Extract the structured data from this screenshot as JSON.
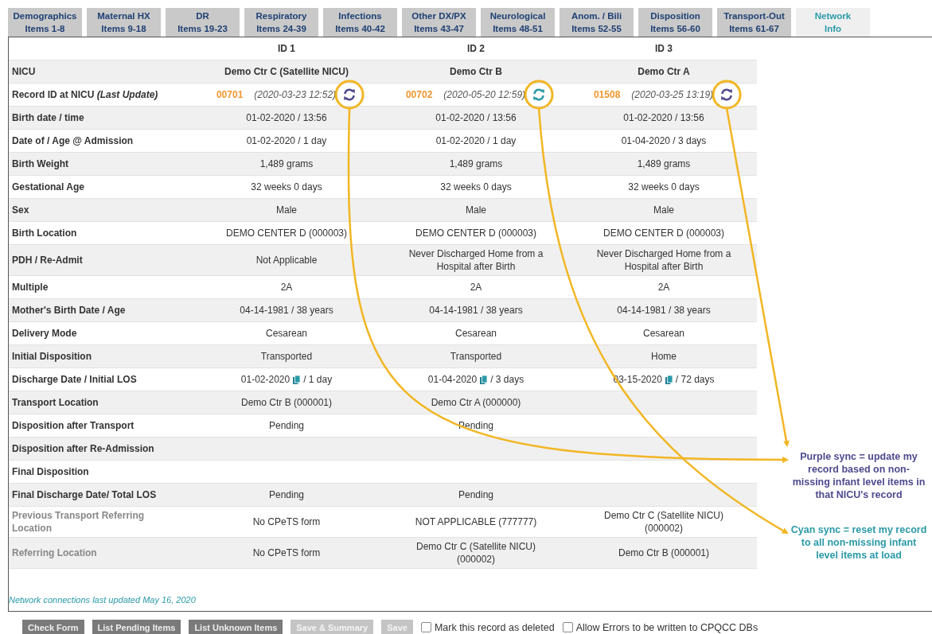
{
  "tabs": [
    {
      "title": "Demographics",
      "items": "Items 1-8",
      "selected": false
    },
    {
      "title": "Maternal HX",
      "items": "Items 9-18",
      "selected": false
    },
    {
      "title": "DR",
      "items": "Items 19-23",
      "selected": false
    },
    {
      "title": "Respiratory",
      "items": "Items 24-39",
      "selected": false
    },
    {
      "title": "Infections",
      "items": "Items 40-42",
      "selected": false
    },
    {
      "title": "Other DX/PX",
      "items": "Items 43-47",
      "selected": false
    },
    {
      "title": "Neurological",
      "items": "Items 48-51",
      "selected": false
    },
    {
      "title": "Anom. / Bili",
      "items": "Items 52-55",
      "selected": false
    },
    {
      "title": "Disposition",
      "items": "Items 56-60",
      "selected": false
    },
    {
      "title": "Transport-Out",
      "items": "Items 61-67",
      "selected": false
    },
    {
      "title": "Network",
      "items": "Info",
      "selected": true
    }
  ],
  "table": {
    "columns": [
      "ID 1",
      "ID 2",
      "ID 3"
    ],
    "rows": [
      {
        "kind": "heading",
        "label": "NICU",
        "cells": [
          "Demo Ctr C (Satellite NICU)",
          "Demo Ctr B",
          "Demo Ctr A"
        ]
      },
      {
        "kind": "record",
        "label": "Record ID at NICU *(Last Update)*",
        "cells": [
          {
            "id": "00701",
            "updated": "(2020-03-23 12:52)",
            "color": "#4f4a8f"
          },
          {
            "id": "00702",
            "updated": "(2020-05-20 12:59)",
            "color": "#2a9aa8"
          },
          {
            "id": "01508",
            "updated": "(2020-03-25 13:19)",
            "color": "#4f4a8f"
          }
        ]
      },
      {
        "kind": "plain",
        "label": "Birth date / time",
        "cells": [
          "01-02-2020 / 13:56",
          "01-02-2020 / 13:56",
          "01-02-2020 / 13:56"
        ]
      },
      {
        "kind": "plain",
        "label": "Date of / Age @ Admission",
        "cells": [
          "01-02-2020 / 1 day",
          "01-02-2020 / 1 day",
          "01-04-2020 / 3 days"
        ]
      },
      {
        "kind": "plain",
        "label": "Birth Weight",
        "cells": [
          "1,489 grams",
          "1,489 grams",
          "1,489 grams"
        ]
      },
      {
        "kind": "plain",
        "label": "Gestational Age",
        "cells": [
          "32 weeks 0 days",
          "32 weeks 0 days",
          "32 weeks 0 days"
        ]
      },
      {
        "kind": "plain",
        "label": "Sex",
        "cells": [
          "Male",
          "Male",
          "Male"
        ]
      },
      {
        "kind": "plain",
        "label": "Birth Location",
        "cells": [
          "DEMO CENTER D (000003)",
          "DEMO CENTER D (000003)",
          "DEMO CENTER D (000003)"
        ]
      },
      {
        "kind": "plain",
        "label": "PDH / Re-Admit",
        "cells": [
          "Not Applicable",
          "Never Discharged Home from a Hospital after Birth",
          "Never Discharged Home from a Hospital after Birth"
        ]
      },
      {
        "kind": "plain",
        "label": "Multiple",
        "cells": [
          "2A",
          "2A",
          "2A"
        ]
      },
      {
        "kind": "plain",
        "label": "Mother's Birth Date / Age",
        "cells": [
          "04-14-1981 / 38 years",
          "04-14-1981 / 38 years",
          "04-14-1981 / 38 years"
        ]
      },
      {
        "kind": "plain",
        "label": "Delivery Mode",
        "cells": [
          "Cesarean",
          "Cesarean",
          "Cesarean"
        ]
      },
      {
        "kind": "plain",
        "label": "Initial Disposition",
        "cells": [
          "Transported",
          "Transported",
          "Home"
        ]
      },
      {
        "kind": "discharge",
        "label": "Discharge Date / Initial LOS",
        "cells": [
          {
            "date": "01-02-2020",
            "rest": "/ 1 day"
          },
          {
            "date": "01-04-2020",
            "rest": "/ 3 days"
          },
          {
            "date": "03-15-2020",
            "rest": "/ 72 days"
          }
        ]
      },
      {
        "kind": "plain",
        "label": "Transport Location",
        "cells": [
          "Demo Ctr B (000001)",
          "Demo Ctr A (000000)",
          null
        ]
      },
      {
        "kind": "plain",
        "label": "Disposition after Transport",
        "cells": [
          "Pending",
          "Pending",
          null
        ]
      },
      {
        "kind": "plain",
        "label": "Disposition after Re-Admission",
        "cells": [
          null,
          null,
          null
        ]
      },
      {
        "kind": "plain",
        "label": "Final Disposition",
        "cells": [
          null,
          null,
          null
        ]
      },
      {
        "kind": "plain",
        "label": "Final Discharge Date/ Total LOS",
        "cells": [
          "Pending",
          "Pending",
          null
        ]
      },
      {
        "kind": "muted",
        "label": "Previous Transport Referring Location",
        "cells": [
          "No CPeTS form",
          "NOT APPLICABLE (777777)",
          "Demo Ctr C (Satellite NICU) (000002)"
        ]
      },
      {
        "kind": "muted",
        "label": "Referring Location",
        "cells": [
          "No CPeTS form",
          "Demo Ctr C (Satellite NICU) (000002)",
          "Demo Ctr B (000001)"
        ]
      }
    ]
  },
  "notes": [
    {
      "text": "Purple sync = update my record based on non-missing infant level items in that NICU's record",
      "color": "#4f4a8f"
    },
    {
      "text": "Cyan sync = reset my record to all non-missing infant level items at load",
      "color": "#2a9aa8"
    }
  ],
  "footer_note": "Network connections last updated May 16, 2020",
  "buttons": [
    {
      "label": "Check Form",
      "disabled": false
    },
    {
      "label": "List Pending Items",
      "disabled": false
    },
    {
      "label": "List Unknown Items",
      "disabled": false
    },
    {
      "label": "Save & Summary",
      "disabled": true
    },
    {
      "label": "Save",
      "disabled": true
    }
  ],
  "checkboxes": [
    {
      "label": "Mark this record as deleted",
      "checked": false
    },
    {
      "label": "Allow Errors to be written to CPQCC DBs",
      "checked": false
    }
  ]
}
